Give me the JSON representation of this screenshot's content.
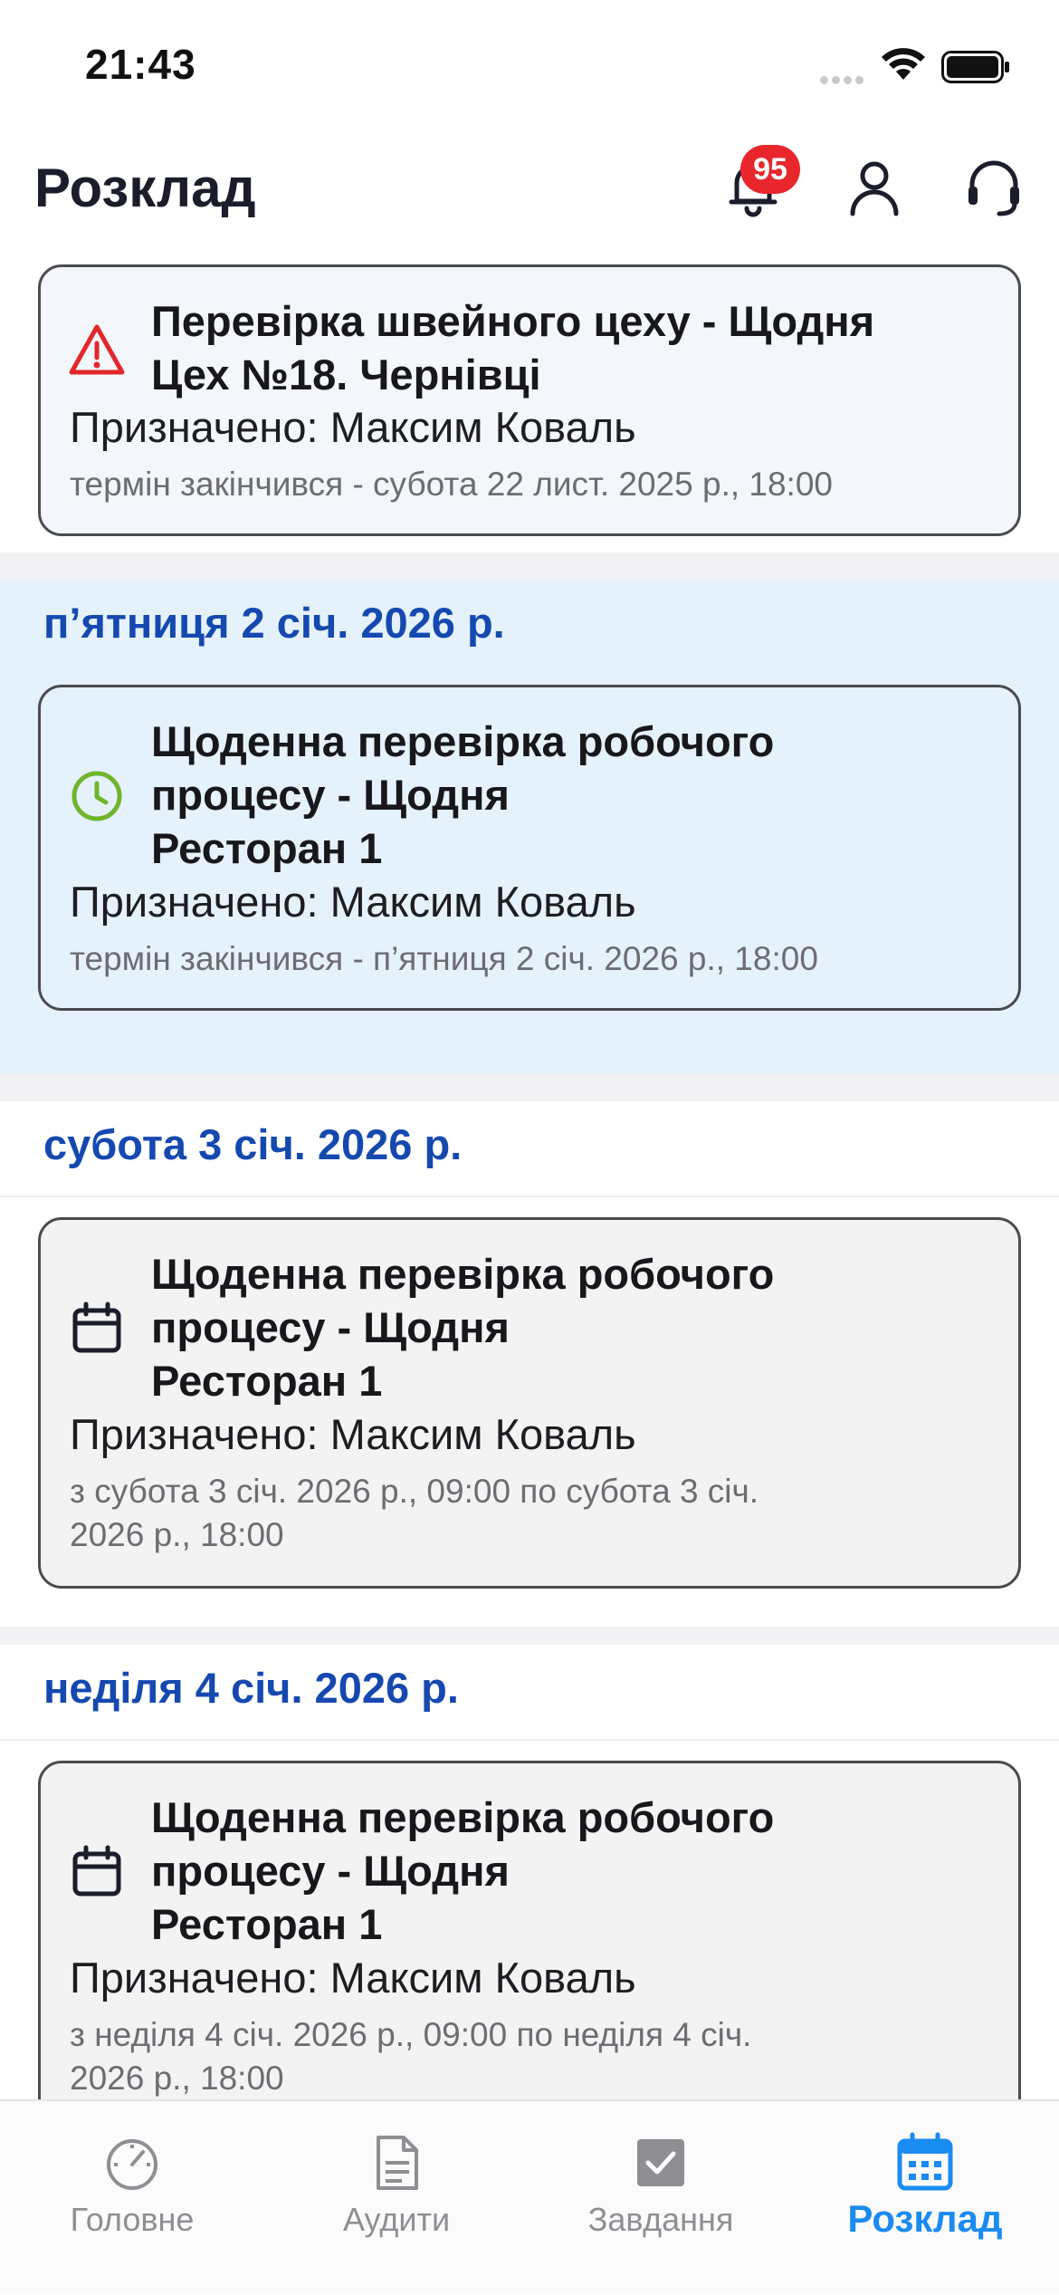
{
  "status_bar": {
    "time": "21:43"
  },
  "header": {
    "title": "Розклад",
    "notifications_count": "95"
  },
  "overdue_section": {
    "card": {
      "title_line1": "Перевірка швейного цеху - Щодня",
      "title_line2": "Цех №18. Чернівці",
      "assignee": "Призначено: Максим Коваль",
      "time": "термін закінчився - субота 22 лист. 2025 р., 18:00",
      "icon": "warning-icon",
      "icon_color": "#e2262c"
    }
  },
  "sections": [
    {
      "date": "п’ятниця 2 січ. 2026 р.",
      "card": {
        "title_line1": "Щоденна перевірка робочого",
        "title_line2": "процесу - Щодня",
        "title_line3": "Ресторан 1",
        "assignee": "Призначено: Максим Коваль",
        "time": "термін закінчився - п’ятниця 2 січ. 2026 р., 18:00",
        "icon": "clock-icon",
        "icon_color": "#6fb52c"
      }
    },
    {
      "date": "субота 3 січ. 2026 р.",
      "card": {
        "title_line1": "Щоденна перевірка робочого",
        "title_line2": "процесу - Щодня",
        "title_line3": "Ресторан 1",
        "assignee": "Призначено: Максим Коваль",
        "time_line1": "з субота 3 січ. 2026 р., 09:00 по субота 3 січ.",
        "time_line2": "2026 р., 18:00",
        "icon": "calendar-icon"
      }
    },
    {
      "date": "неділя 4 січ. 2026 р.",
      "card": {
        "title_line1": "Щоденна перевірка робочого",
        "title_line2": "процесу - Щодня",
        "title_line3": "Ресторан 1",
        "assignee": "Призначено: Максим Коваль",
        "time_line1": "з неділя 4 січ. 2026 р., 09:00 по неділя 4 січ.",
        "time_line2": "2026 р., 18:00",
        "icon": "calendar-icon"
      }
    }
  ],
  "tab_bar": {
    "tabs": [
      {
        "label": "Головне",
        "icon": "speedometer-icon"
      },
      {
        "label": "Аудити",
        "icon": "document-icon"
      },
      {
        "label": "Завдання",
        "icon": "checkbox-icon"
      },
      {
        "label": "Розклад",
        "icon": "calendar-icon",
        "active": true
      }
    ],
    "active_color": "#1a8bf0",
    "inactive_color": "#8e8e93"
  }
}
